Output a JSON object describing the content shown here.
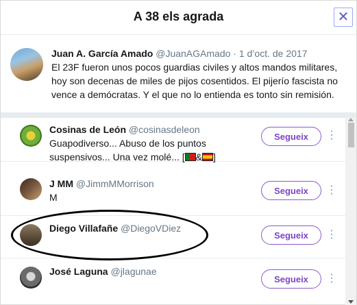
{
  "modal": {
    "title": "A 38 els agrada",
    "close_glyph": "✕"
  },
  "tweet": {
    "author_name": "Juan A. García Amado",
    "author_handle": "@JuanAGAmado",
    "separator": "·",
    "date": "1 d’oct. de 2017",
    "text": "El 23F fueron unos pocos guardias civiles y altos mandos militares, hoy son decenas de miles de pijos cosentidos. El pijerío fascista no vence a demócratas. Y el que no lo entienda es tonto sin remisión."
  },
  "users": [
    {
      "name": "Cosinas de León",
      "handle": "@cosinasdeleon",
      "bio_line1": "Guapodiverso... Abuso de los puntos",
      "bio_line2_prefix": "suspensivos... Una vez molé... [",
      "bio_line2_amp": "&",
      "bio_line2_suffix": "]",
      "follow_label": "Segueix"
    },
    {
      "name": "J MM",
      "handle": "@JimmMMorrison",
      "bio_line1": "M",
      "follow_label": "Segueix"
    },
    {
      "name": "Diego Villafañe",
      "handle": "@DiegoVDiez",
      "follow_label": "Segueix"
    },
    {
      "name": "José Laguna",
      "handle": "@jlagunae",
      "follow_label": "Segueix"
    }
  ],
  "more_glyph": "⋮",
  "icons": {
    "close": "close-icon",
    "more": "more-vertical-icon",
    "flag_1": "portugal-flag-icon",
    "flag_2": "spain-flag-icon"
  },
  "colors": {
    "accent": "#7e45c4",
    "follow_border": "#8a5acb",
    "handle": "#657786",
    "divider": "#e6ecf0"
  }
}
